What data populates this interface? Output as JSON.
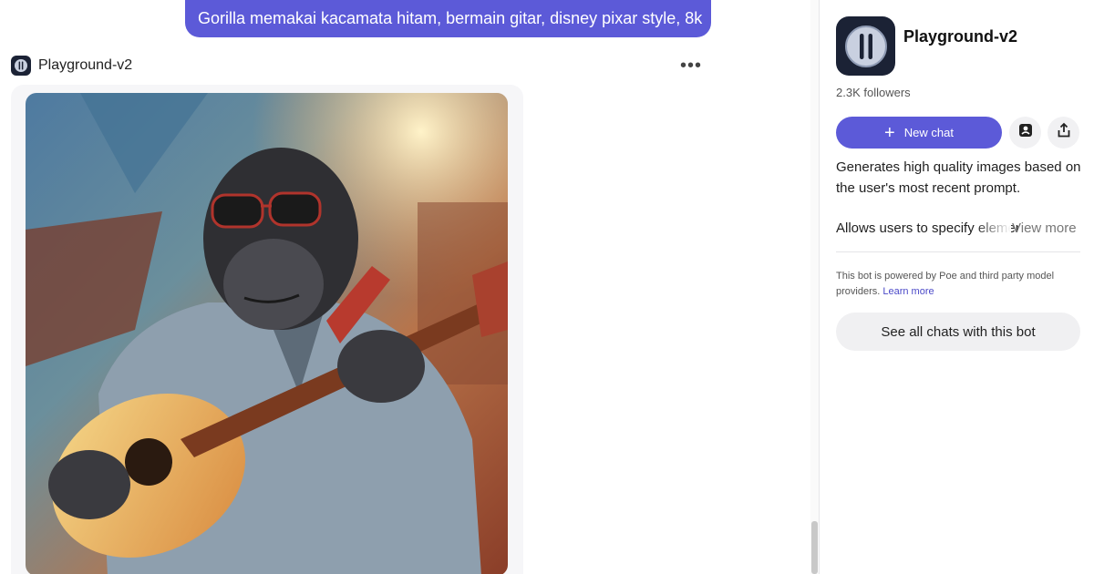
{
  "chat": {
    "user_prompt": "Gorilla memakai kacamata hitam, bermain gitar, disney pixar style, 8k",
    "bot_name": "Playground-v2",
    "more_label": "•••"
  },
  "sidebar": {
    "title": "Playground-v2",
    "followers": "2.3K followers",
    "new_chat_label": "New chat",
    "description": "Generates high quality images based on the user's most recent prompt.",
    "description_more": "Allows users to specify elements",
    "view_more_label": "View more",
    "powered_text": "This bot is powered by Poe and third party model providers.",
    "learn_more_label": "Learn more",
    "see_all_label": "See all chats with this bot"
  },
  "colors": {
    "accent": "#5c5ad8",
    "bot_avatar_bg": "#1b2235"
  },
  "icons": [
    "playground-logo-icon",
    "more-dots-icon",
    "plus-icon",
    "bot-profile-icon",
    "share-icon"
  ]
}
